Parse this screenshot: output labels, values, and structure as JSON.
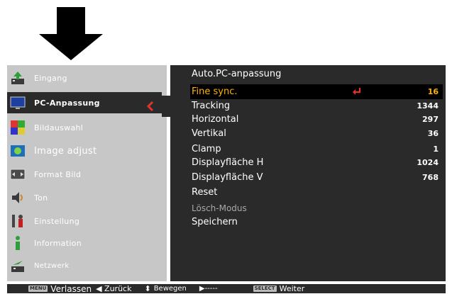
{
  "left_menu": {
    "items": [
      {
        "label": "Eingang",
        "icon": "input-icon"
      },
      {
        "label": "PC-Anpassung",
        "icon": "monitor-icon",
        "active": true
      },
      {
        "label": "Bildauswahl",
        "icon": "image-select-icon"
      },
      {
        "label": "Image adjust",
        "icon": "image-adjust-icon"
      },
      {
        "label": "Format Bild",
        "icon": "screen-format-icon"
      },
      {
        "label": "Ton",
        "icon": "speaker-icon"
      },
      {
        "label": "Einstellung",
        "icon": "settings-icon"
      },
      {
        "label": "Information",
        "icon": "information-icon"
      },
      {
        "label": "Netzwerk",
        "icon": "network-icon"
      }
    ]
  },
  "right_panel": {
    "title": "Auto.PC-anpassung",
    "rows": [
      {
        "label": "Fine sync.",
        "value": "16",
        "selected": true
      },
      {
        "label": "Tracking",
        "value": "1344"
      },
      {
        "label": "Horizontal",
        "value": "297"
      },
      {
        "label": "Vertikal",
        "value": "36"
      },
      {
        "label": "Clamp",
        "value": "1"
      },
      {
        "label": "Displayfläche H",
        "value": "1024"
      },
      {
        "label": "Displayfläche V",
        "value": "768"
      },
      {
        "label": "Reset",
        "value": ""
      },
      {
        "label": "Lösch-Modus",
        "value": "",
        "dim": true
      },
      {
        "label": "Speichern",
        "value": ""
      }
    ]
  },
  "bottom_bar": {
    "menu_button": "MENU",
    "exit_label": "Verlassen",
    "back_label": "◀ Zurück",
    "move_label": "Bewegen",
    "right_label": "▶-----",
    "select_button": "SELECT",
    "next_label": "Weiter"
  },
  "colors": {
    "panel_dark": "#2a2a2a",
    "panel_light": "#c7c7c7",
    "highlight": "#ffb300",
    "accent_red": "#e0332a"
  }
}
